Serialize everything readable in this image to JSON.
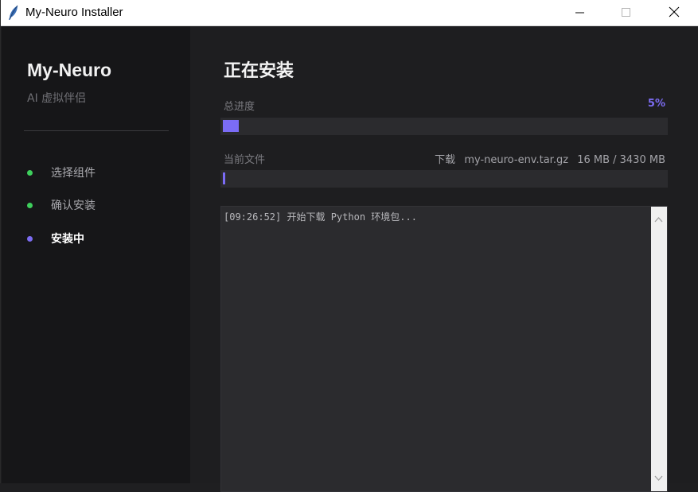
{
  "window": {
    "title": "My-Neuro Installer",
    "icons": {
      "app": "feather-icon",
      "minimize": "minimize-icon",
      "maximize": "maximize-icon",
      "close": "close-icon"
    }
  },
  "sidebar": {
    "brand": "My-Neuro",
    "tagline": "AI 虚拟伴侣",
    "steps": [
      {
        "label": "选择组件",
        "status": "done",
        "color": "#3ecf5c"
      },
      {
        "label": "确认安装",
        "status": "done",
        "color": "#3ecf5c"
      },
      {
        "label": "安装中",
        "status": "active",
        "color": "#7c6cf2"
      }
    ]
  },
  "main": {
    "title": "正在安装",
    "total_progress": {
      "label": "总进度",
      "percent_text": "5%",
      "value": 0.05
    },
    "current_file": {
      "label": "当前文件",
      "action": "下载",
      "filename": "my-neuro-env.tar.gz",
      "size": "16 MB / 3430 MB",
      "value": 0.0047
    },
    "log": {
      "lines": [
        "[09:26:52] 开始下载 Python 环境包..."
      ]
    }
  },
  "colors": {
    "accent": "#7b6cf6",
    "done": "#3ecf5c",
    "background": "#1e1e20",
    "sidebar": "#161618"
  }
}
